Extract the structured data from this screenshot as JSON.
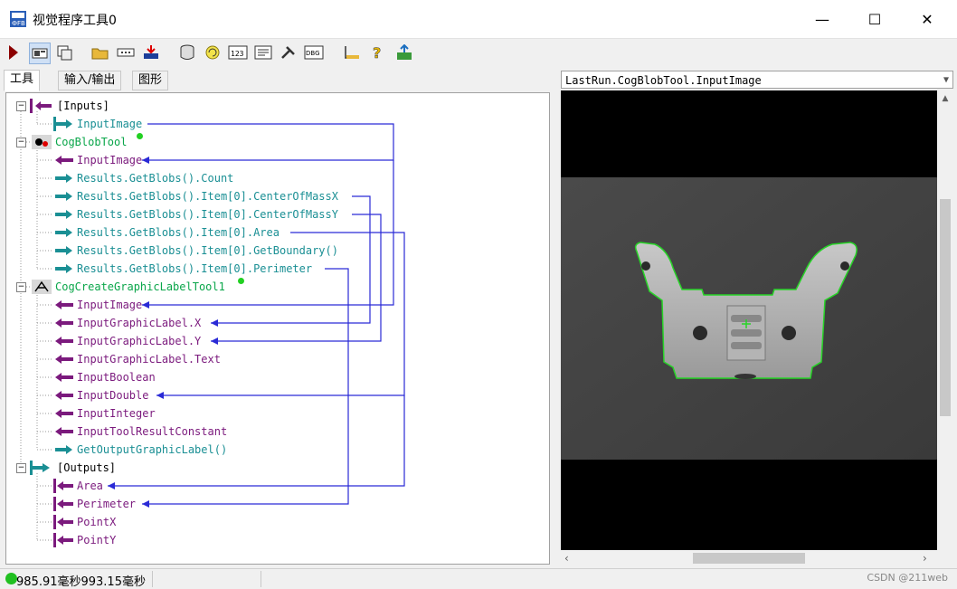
{
  "window": {
    "title": "视觉程序工具0",
    "minimize_glyph": "—",
    "maximize_glyph": "☐",
    "close_glyph": "✕"
  },
  "toolbar": {
    "buttons": [
      "run-icon",
      "display-icon",
      "edit-icon",
      "open-folder-icon",
      "dots-icon",
      "import-icon",
      "database-icon",
      "refresh-icon",
      "counter-icon",
      "list-icon",
      "tools-icon",
      "debug-icon",
      "measure-icon",
      "help-icon",
      "export-icon"
    ]
  },
  "tabs": {
    "tools": "工具",
    "io": "输入/输出",
    "graphics": "图形"
  },
  "tree": {
    "inputs_label": "[Inputs]",
    "inputs_input_image": "InputImage",
    "blob_tool": "CogBlobTool",
    "blob_input_image": "InputImage",
    "blob_count": "Results.GetBlobs().Count",
    "blob_cx": "Results.GetBlobs().Item[0].CenterOfMassX",
    "blob_cy": "Results.GetBlobs().Item[0].CenterOfMassY",
    "blob_area": "Results.GetBlobs().Item[0].Area",
    "blob_boundary": "Results.GetBlobs().Item[0].GetBoundary()",
    "blob_perimeter": "Results.GetBlobs().Item[0].Perimeter",
    "label_tool": "CogCreateGraphicLabelTool1",
    "label_input_image": "InputImage",
    "label_x": "InputGraphicLabel.X",
    "label_y": "InputGraphicLabel.Y",
    "label_text": "InputGraphicLabel.Text",
    "label_bool": "InputBoolean",
    "label_double": "InputDouble",
    "label_int": "InputInteger",
    "label_const": "InputToolResultConstant",
    "label_output": "GetOutputGraphicLabel()",
    "outputs_label": "[Outputs]",
    "out_area": "Area",
    "out_perimeter": "Perimeter",
    "out_pointx": "PointX",
    "out_pointy": "PointY"
  },
  "image_view": {
    "header": "LastRun.CogBlobTool.InputImage"
  },
  "status": {
    "times": "985.91毫秒993.15毫秒",
    "watermark": "CSDN @211web"
  },
  "colors": {
    "link_line": "#2a2ad6",
    "input_arrow": "#7b1a7d",
    "output_arrow": "#1a8f94",
    "tool_name": "#0aa64a",
    "blob_outline": "#27d427"
  }
}
